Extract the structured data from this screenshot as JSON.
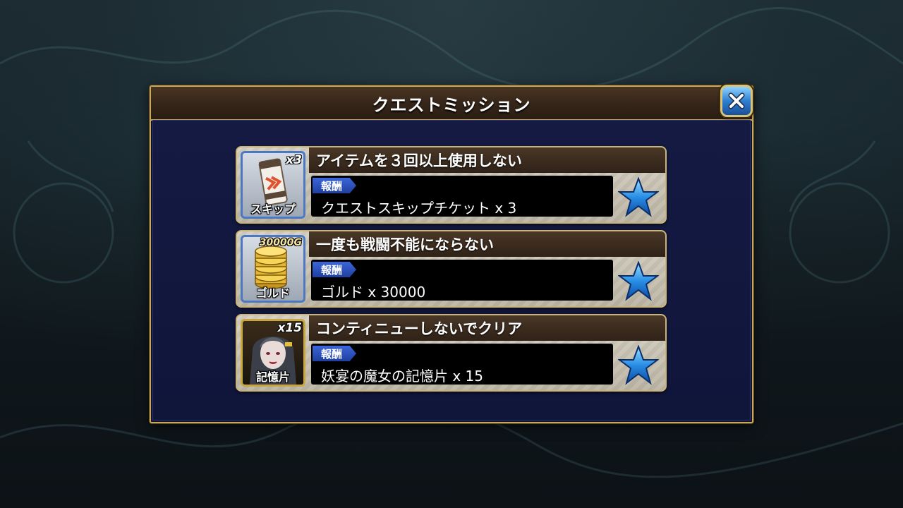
{
  "dialog": {
    "title": "クエストミッション"
  },
  "missions": [
    {
      "title": "アイテムを３回以上使用しない",
      "reward_label": "報酬",
      "reward": "クエストスキップチケット x 3",
      "icon_qty": "x3",
      "icon_caption": "スキップ",
      "icon": "skip-ticket-icon",
      "star_color": "#2a8fe6"
    },
    {
      "title": "一度も戦闘不能にならない",
      "reward_label": "報酬",
      "reward": "ゴルド x 30000",
      "icon_qty": "30000G",
      "icon_caption": "ゴルド",
      "icon": "gold-coins-icon",
      "star_color": "#2a8fe6"
    },
    {
      "title": "コンティニューしないでクリア",
      "reward_label": "報酬",
      "reward": "妖宴の魔女の記憶片 x 15",
      "icon_qty": "x15",
      "icon_caption": "記憶片",
      "icon": "character-portrait-icon",
      "star_color": "#2a8fe6"
    }
  ]
}
